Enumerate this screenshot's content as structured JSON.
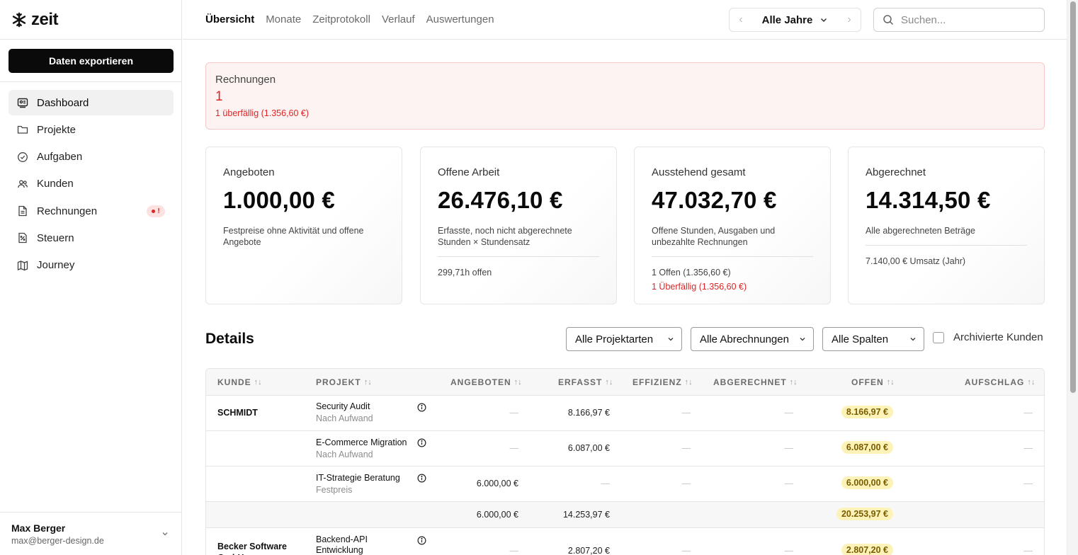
{
  "app": {
    "brand": "zeit",
    "export_label": "Daten exportieren"
  },
  "sidebar": {
    "items": [
      {
        "label": "Dashboard",
        "icon": "dashboard-icon"
      },
      {
        "label": "Projekte",
        "icon": "folder-icon"
      },
      {
        "label": "Aufgaben",
        "icon": "check-circle-icon"
      },
      {
        "label": "Kunden",
        "icon": "users-icon"
      },
      {
        "label": "Rechnungen",
        "icon": "invoice-icon",
        "badge": "!"
      },
      {
        "label": "Steuern",
        "icon": "tax-document-icon"
      },
      {
        "label": "Journey",
        "icon": "map-icon"
      }
    ],
    "user": {
      "name": "Max Berger",
      "email": "max@berger-design.de"
    }
  },
  "topbar": {
    "tabs": [
      "Übersicht",
      "Monate",
      "Zeitprotokoll",
      "Verlauf",
      "Auswertungen"
    ],
    "year_selector": "Alle Jahre",
    "search_placeholder": "Suchen..."
  },
  "alert": {
    "title": "Rechnungen",
    "count": "1",
    "subtitle": "1 überfällig (1.356,60 €)"
  },
  "cards": [
    {
      "label": "Angeboten",
      "value": "1.000,00 €",
      "desc": "Festpreise ohne Aktivität und offene Angebote"
    },
    {
      "label": "Offene Arbeit",
      "value": "26.476,10 €",
      "desc": "Erfasste, noch nicht abgerechnete Stunden × Stundensatz",
      "foot": "299,71h offen"
    },
    {
      "label": "Ausstehend gesamt",
      "value": "47.032,70 €",
      "desc": "Offene Stunden, Ausgaben und unbezahlte Rechnungen",
      "foot": "1 Offen (1.356,60 €)",
      "foot_red": "1 Überfällig (1.356,60 €)"
    },
    {
      "label": "Abgerechnet",
      "value": "14.314,50 €",
      "desc": "Alle abgerechneten Beträge",
      "foot": "7.140,00 € Umsatz (Jahr)"
    }
  ],
  "details": {
    "title": "Details",
    "filter_project_types": "Alle Projektarten",
    "filter_billing": "Alle Abrechnungen",
    "filter_columns": "Alle Spalten",
    "archived_label": "Archivierte Kunden"
  },
  "table": {
    "headers": [
      "KUNDE",
      "PROJEKT",
      "ANGEBOTEN",
      "ERFASST",
      "EFFIZIENZ",
      "ABGERECHNET",
      "OFFEN",
      "AUFSCHLAG"
    ],
    "sort_glyph": "↑↓",
    "dash": "—",
    "rows": [
      {
        "customer": "SCHMIDT",
        "project": "Security Audit",
        "type": "Nach Aufwand",
        "offered": "—",
        "recorded": "8.166,97 €",
        "efficiency": "—",
        "billed": "—",
        "open": "8.166,97 €",
        "markup": "—"
      },
      {
        "customer": "",
        "project": "E-Commerce Migration",
        "type": "Nach Aufwand",
        "offered": "—",
        "recorded": "6.087,00 €",
        "efficiency": "—",
        "billed": "—",
        "open": "6.087,00 €",
        "markup": "—"
      },
      {
        "customer": "",
        "project": "IT-Strategie Beratung",
        "type": "Festpreis",
        "offered": "6.000,00 €",
        "recorded": "—",
        "efficiency": "—",
        "billed": "—",
        "open": "6.000,00 €",
        "markup": "—"
      }
    ],
    "subtotal": {
      "offered": "6.000,00 €",
      "recorded": "14.253,97 €",
      "open": "20.253,97 €"
    },
    "next_row": {
      "customer": "Becker Software GmbH",
      "project": "Backend-API Entwicklung",
      "offered": "—",
      "recorded": "2.807,20 €",
      "efficiency": "—",
      "billed": "—",
      "open": "2.807,20 €",
      "markup": "—"
    }
  }
}
